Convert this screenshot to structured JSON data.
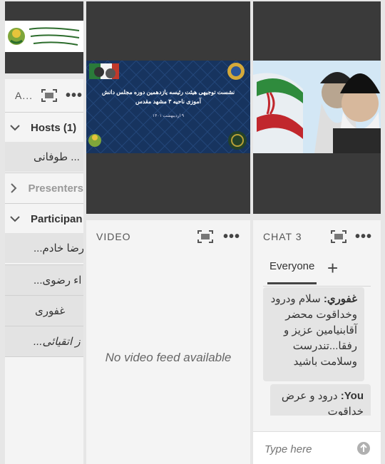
{
  "left_panel": {
    "logo_alt": "مجمع آموزشی آموزش و پرورش ناحیه ۳ مشهد مقدس",
    "attendees_title": "A...",
    "hosts": {
      "label": "Hosts (1)",
      "items": [
        "... طوفانی"
      ]
    },
    "presenters": {
      "label": "Presenters"
    },
    "participants": {
      "label": "Participan",
      "items": [
        "...رضا خادم",
        "...اء رضوی",
        "غفوری",
        "...ز اتقیائی"
      ]
    }
  },
  "slide": {
    "title_line1": "نشست توجیهی هیئت رئیسه یازدهمین دوره مجلس دانش",
    "title_line2": "آموزی ناحیه ۳ مشهد مقدس",
    "date": "۹ اردیبهشت ۱۴۰۱"
  },
  "video": {
    "title": "VIDEO",
    "empty_text": "No video feed available"
  },
  "chat": {
    "title": "CHAT 3",
    "tab_everyone": "Everyone",
    "add_tab": "+",
    "messages": [
      {
        "author": "غفوري:",
        "text": "سلام ودرود وخداقوت محضر آقابنیامین عزیز و رفقا...تندرست وسلامت باشید"
      },
      {
        "author": "You:",
        "text": "درود و عرض خداقوت"
      }
    ],
    "input_placeholder": "Type here"
  },
  "colors": {
    "accent": "#6c9b32",
    "dark_pod": "#3a3a3a"
  }
}
